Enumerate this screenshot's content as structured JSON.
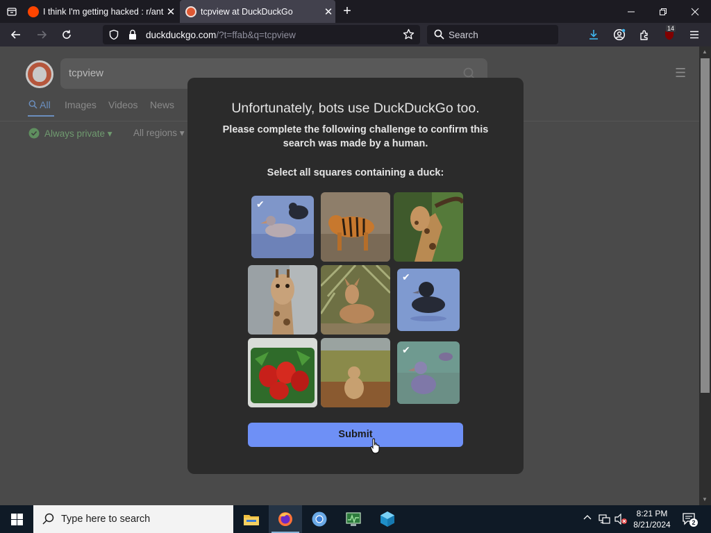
{
  "browser": {
    "tabs": [
      {
        "title": "I think I'm getting hacked : r/ant",
        "close": "✕"
      },
      {
        "title": "tcpview at DuckDuckGo",
        "close": "✕"
      }
    ],
    "new_tab": "+",
    "url_host": "duckduckgo.com",
    "url_rest": "/?t=ffab&q=tcpview",
    "search_placeholder": "Search",
    "ublock_count": "14"
  },
  "ddg": {
    "query": "tcpview",
    "tabs": [
      "All",
      "Images",
      "Videos",
      "News"
    ],
    "filters": {
      "privacy": "Always private ▾",
      "region": "All regions ▾"
    }
  },
  "captcha": {
    "title": "Unfortunately, bots use DuckDuckGo too.",
    "subtitle": "Please complete the following challenge to confirm this search was made by a human.",
    "prompt": "Select all squares containing a duck:",
    "tiles": [
      {
        "subject": "duck",
        "selected": true
      },
      {
        "subject": "tiger",
        "selected": false
      },
      {
        "subject": "giraffe",
        "selected": false
      },
      {
        "subject": "giraffe",
        "selected": false
      },
      {
        "subject": "deer",
        "selected": false
      },
      {
        "subject": "duck",
        "selected": true
      },
      {
        "subject": "peppers",
        "selected": false
      },
      {
        "subject": "lion",
        "selected": false
      },
      {
        "subject": "duck",
        "selected": true
      }
    ],
    "submit_label": "Submit"
  },
  "taskbar": {
    "search_placeholder": "Type here to search",
    "time": "8:21 PM",
    "date": "8/21/2024",
    "notification_count": "2"
  },
  "colors": {
    "chrome_bg": "#1c1b22",
    "toolbar_bg": "#2b2a33",
    "modal_bg": "#2b2b2b",
    "submit_bg": "#6e90f6",
    "tile_selected_tint": "#6f86d6",
    "taskbar_bg": "#0f1a26"
  }
}
